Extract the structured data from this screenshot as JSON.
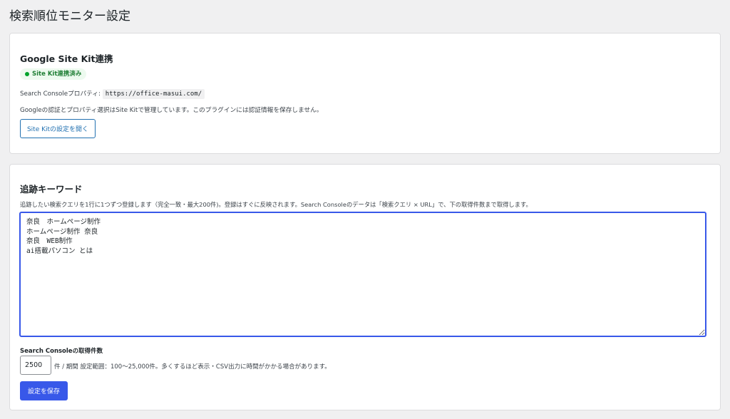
{
  "page": {
    "title": "検索順位モニター設定"
  },
  "sitekit": {
    "title": "Google Site Kit連携",
    "status_badge": "Site Kit連携済み",
    "property_label": "Search Consoleプロパティ:",
    "property_value": "https://office-masui.com/",
    "note": "Googleの認証とプロパティ選択はSite Kitで管理しています。このプラグインには認証情報を保存しません。",
    "open_button": "Site Kitの設定を開く",
    "colors": {
      "badge_bg": "#edfaef",
      "badge_text": "#1e7e34",
      "link": "#2271b1"
    }
  },
  "keywords": {
    "title": "追跡キーワード",
    "description": "追跡したい検索クエリを1行に1つずつ登録します（完全一致・最大200件)。登録はすぐに反映されます。Search Consoleのデータは「検索クエリ × URL」で、下の取得件数まで取得します。",
    "textarea_value": "奈良　ホームページ制作\nホームページ制作 奈良\n奈良　WEB制作\nai搭載パソコン とは",
    "fetch_count_label": "Search Consoleの取得件数",
    "fetch_count_value": "2500",
    "fetch_count_help": "件 / 期間 設定範囲：100〜25,000件。多くするほど表示・CSV出力に時間がかかる場合があります。",
    "save_button": "設定を保存",
    "colors": {
      "accent": "#3858e9"
    }
  }
}
